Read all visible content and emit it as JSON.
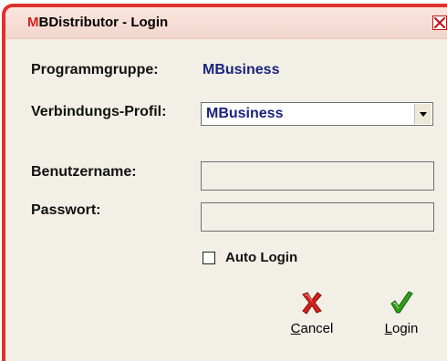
{
  "window": {
    "title_accent": "M",
    "title_rest": "BDistributor - Login"
  },
  "form": {
    "programmgruppe_label": "Programmgruppe:",
    "programmgruppe_value": "MBusiness",
    "profil_label": "Verbindungs-Profil:",
    "profil_value": "MBusiness",
    "benutzername_label": "Benutzername:",
    "benutzername_value": "",
    "passwort_label": "Passwort:",
    "passwort_value": "",
    "auto_login_label": "Auto Login",
    "auto_login_checked": false
  },
  "buttons": {
    "cancel_underline": "C",
    "cancel_rest": "ancel",
    "login_underline": "L",
    "login_rest": "ogin"
  },
  "colors": {
    "frame": "#e0312a",
    "value_text": "#1a237e",
    "cancel_icon": "#d5221b",
    "login_icon": "#2e9e1a"
  }
}
